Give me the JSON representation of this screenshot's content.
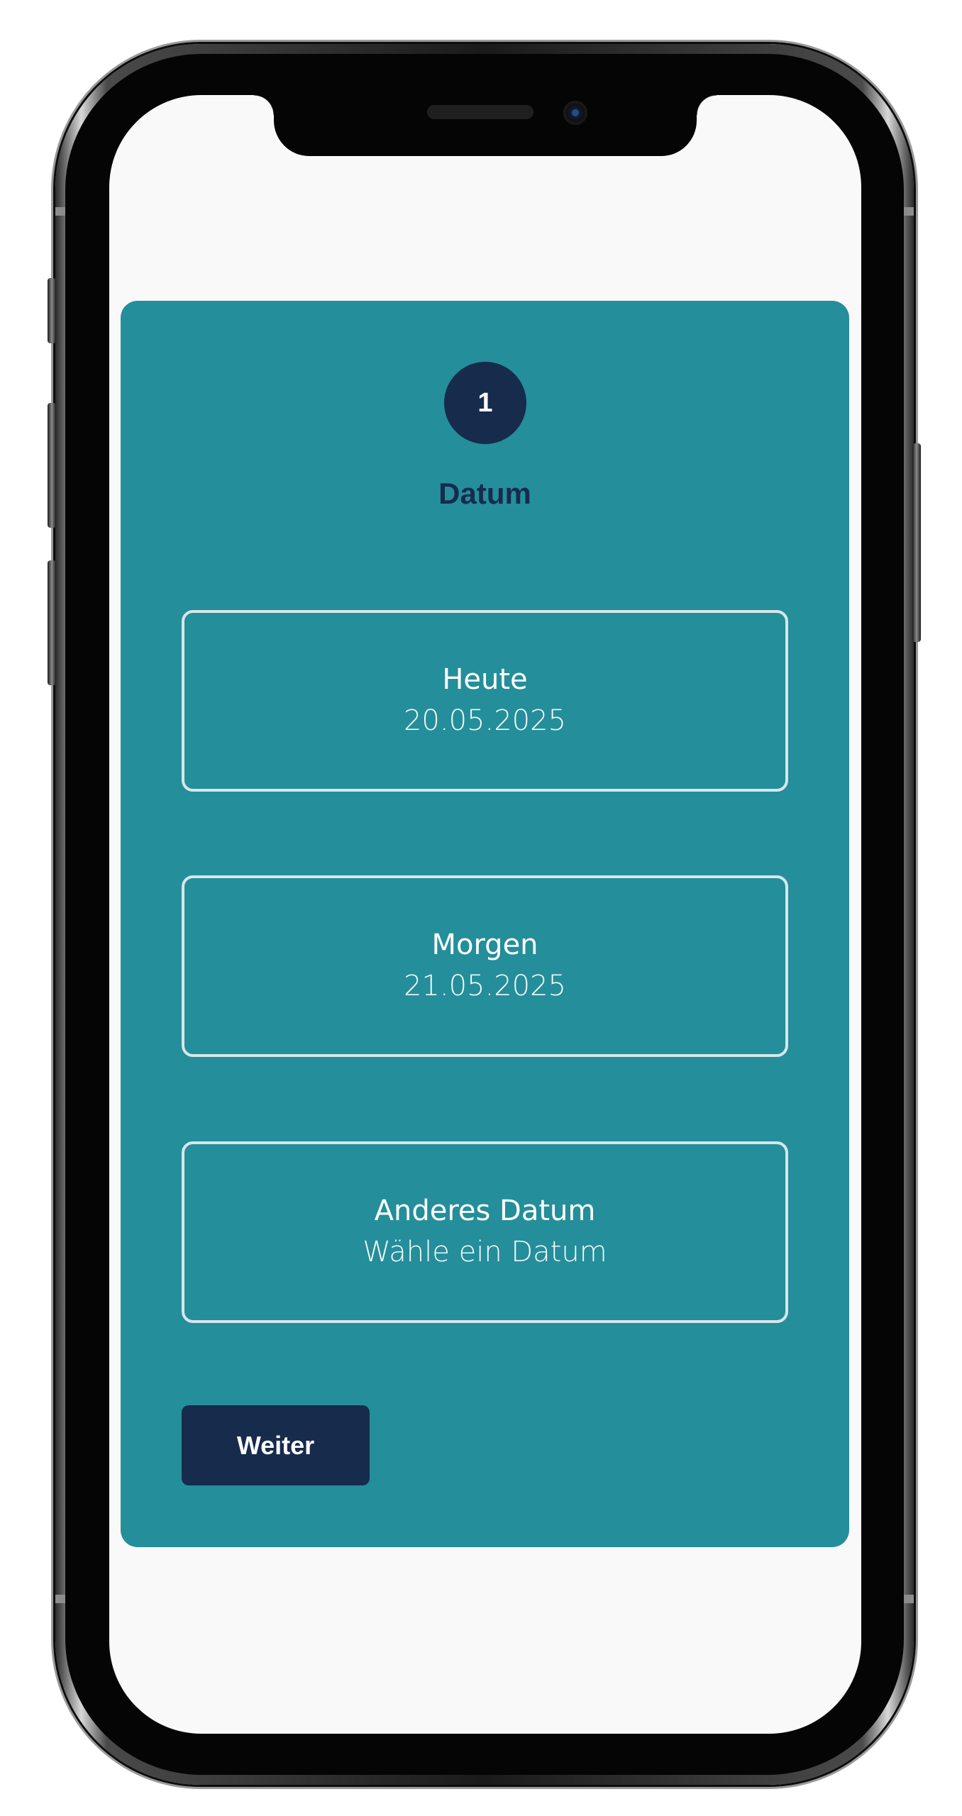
{
  "wizard": {
    "step_number": "1",
    "step_title": "Datum",
    "options": [
      {
        "label": "Heute",
        "sub": "20.05.2025"
      },
      {
        "label": "Morgen",
        "sub": "21.05.2025"
      },
      {
        "label": "Anderes Datum",
        "sub": "Wähle ein Datum"
      }
    ],
    "next_label": "Weiter"
  },
  "colors": {
    "card_background": "#248e9b",
    "primary_dark": "#172b4d",
    "option_border": "#d6e7ea",
    "screen_background": "#f9f9f9"
  }
}
